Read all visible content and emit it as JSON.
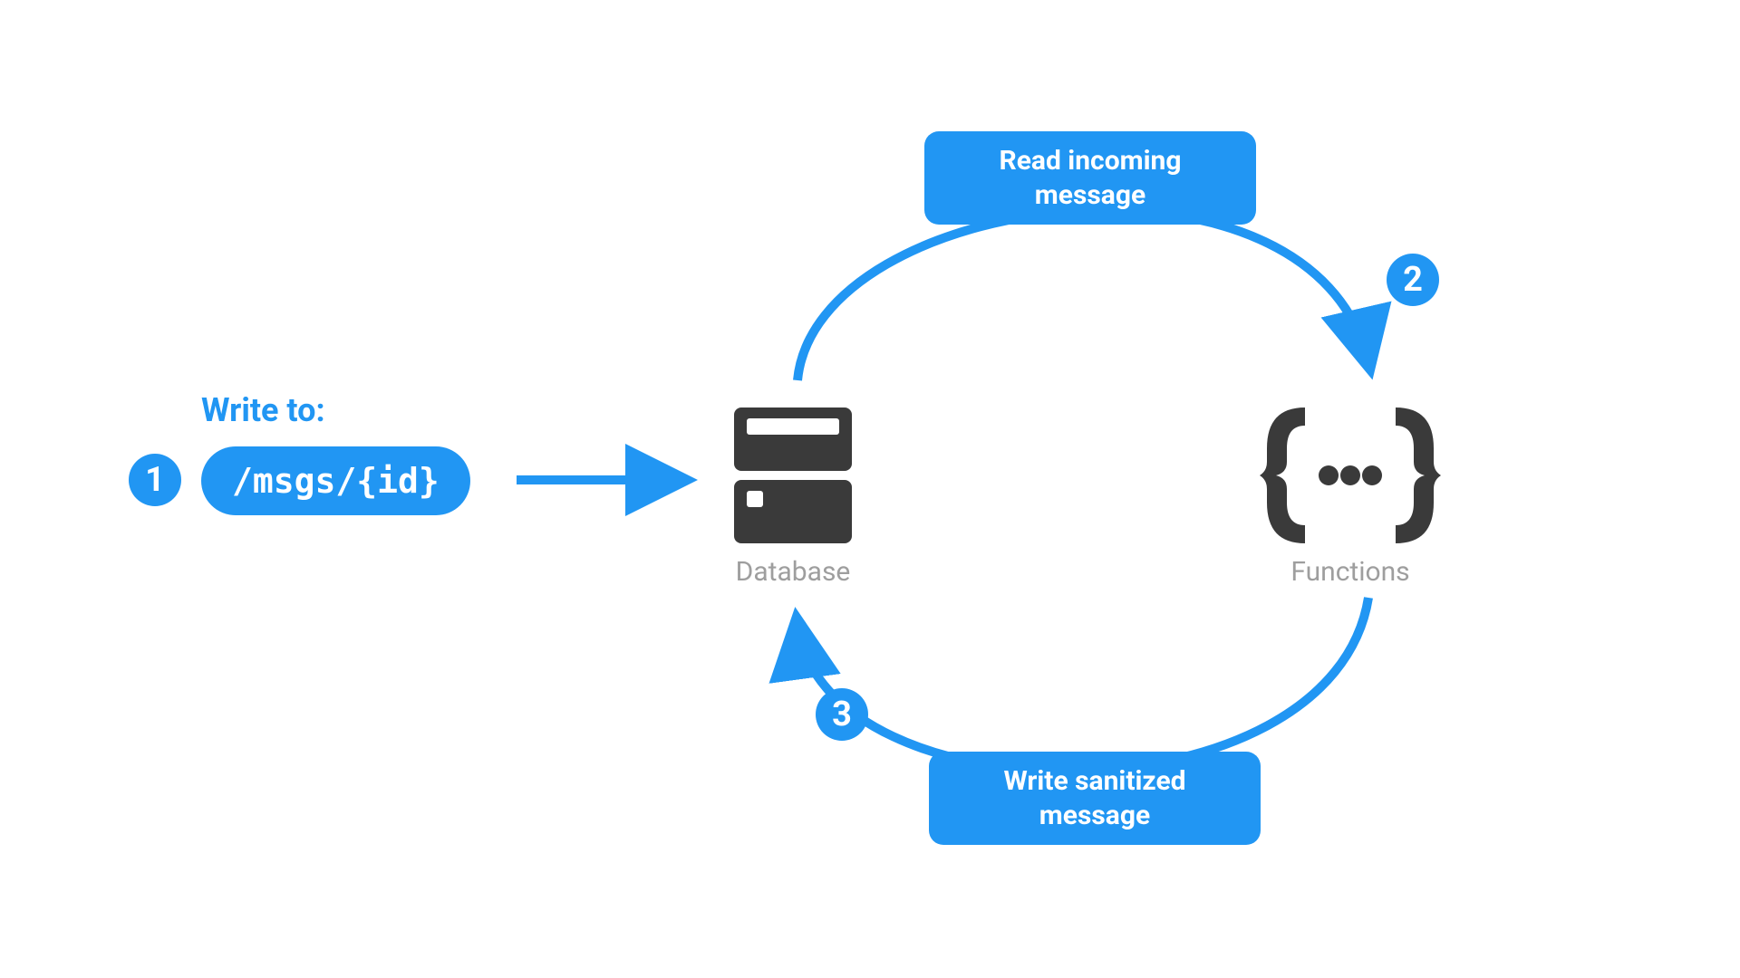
{
  "colors": {
    "accent": "#2196f3",
    "icon": "#3A3A3A",
    "muted": "#9e9e9e"
  },
  "step1": {
    "badge": "1",
    "title": "Write to:",
    "path": "/msgs/{id}"
  },
  "topBox": {
    "line1": "Read incoming",
    "line2": "message"
  },
  "bottomBox": {
    "line1": "Write sanitized",
    "line2": "message"
  },
  "badges": {
    "two": "2",
    "three": "3"
  },
  "nodes": {
    "database": "Database",
    "functions": "Functions"
  }
}
